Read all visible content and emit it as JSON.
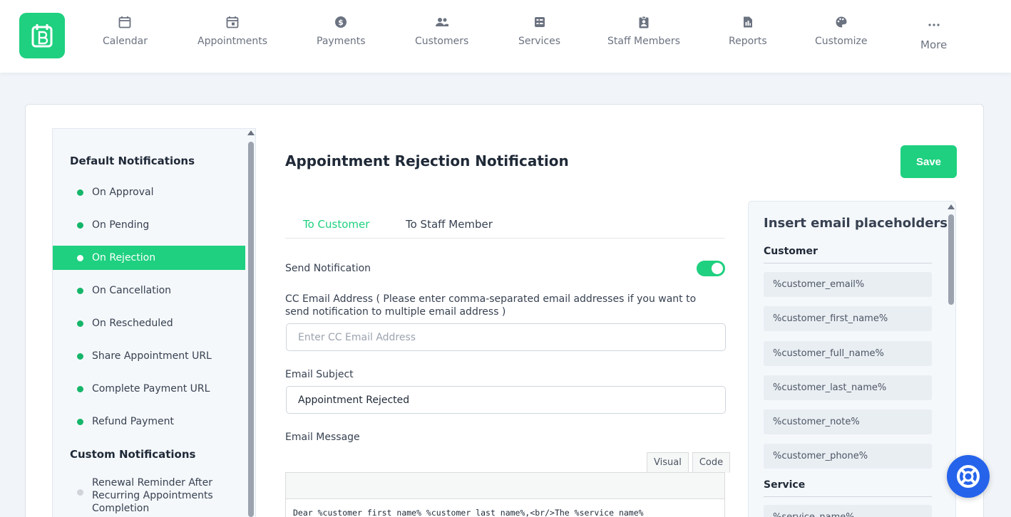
{
  "nav": {
    "items": [
      {
        "label": "Calendar",
        "icon": "calendar-icon"
      },
      {
        "label": "Appointments",
        "icon": "appointment-icon"
      },
      {
        "label": "Payments",
        "icon": "dollar-icon"
      },
      {
        "label": "Customers",
        "icon": "users-icon"
      },
      {
        "label": "Services",
        "icon": "services-icon"
      },
      {
        "label": "Staff Members",
        "icon": "staff-badge-icon"
      },
      {
        "label": "Reports",
        "icon": "report-icon"
      },
      {
        "label": "Customize",
        "icon": "palette-icon"
      },
      {
        "label": "More",
        "icon": "more-dots-icon"
      }
    ]
  },
  "sidebar": {
    "default_heading": "Default Notifications",
    "items": [
      {
        "label": "On Approval"
      },
      {
        "label": "On Pending"
      },
      {
        "label": "On Rejection"
      },
      {
        "label": "On Cancellation"
      },
      {
        "label": "On Rescheduled"
      },
      {
        "label": "Share Appointment URL"
      },
      {
        "label": "Complete Payment URL"
      },
      {
        "label": "Refund Payment"
      }
    ],
    "active_index": 2,
    "custom_heading": "Custom Notifications",
    "custom_items": [
      {
        "label": "Renewal Reminder After Recurring Appointments Completion"
      }
    ]
  },
  "main": {
    "title": "Appointment Rejection Notification",
    "save_label": "Save",
    "tabs": [
      {
        "label": "To Customer",
        "active": true
      },
      {
        "label": "To Staff Member",
        "active": false
      }
    ],
    "send_notification_label": "Send Notification",
    "send_notification_on": true,
    "cc_label": "CC Email Address ( Please enter comma-separated email addresses if you want to send notification to multiple email address )",
    "cc_placeholder": "Enter CC Email Address",
    "cc_value": "",
    "subject_label": "Email Subject",
    "subject_value": "Appointment Rejected",
    "message_label": "Email Message",
    "editor_tabs": {
      "visual": "Visual",
      "code": "Code"
    },
    "message_preview": "Dear %customer_first_name% %customer_last_name%,<br/>The %service_name%"
  },
  "placeholders": {
    "title": "Insert email placeholders",
    "groups": [
      {
        "name": "Customer",
        "items": [
          "%customer_email%",
          "%customer_first_name%",
          "%customer_full_name%",
          "%customer_last_name%",
          "%customer_note%",
          "%customer_phone%"
        ]
      },
      {
        "name": "Service",
        "items": [
          "%service_name%"
        ]
      }
    ]
  },
  "colors": {
    "accent": "#1ed07f",
    "help_button": "#2563eb"
  }
}
